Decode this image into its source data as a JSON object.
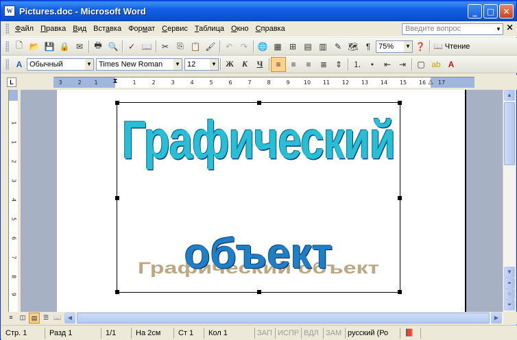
{
  "window": {
    "title": "Pictures.doc - Microsoft Word",
    "app_icon": "W"
  },
  "menubar": {
    "items": [
      {
        "pre": "",
        "u": "Ф",
        "post": "айл"
      },
      {
        "pre": "",
        "u": "П",
        "post": "равка"
      },
      {
        "pre": "",
        "u": "В",
        "post": "ид"
      },
      {
        "pre": "Вст",
        "u": "а",
        "post": "вка"
      },
      {
        "pre": "Фор",
        "u": "м",
        "post": "ат"
      },
      {
        "pre": "",
        "u": "С",
        "post": "ервис"
      },
      {
        "pre": "",
        "u": "Т",
        "post": "аблица"
      },
      {
        "pre": "",
        "u": "О",
        "post": "кно"
      },
      {
        "pre": "",
        "u": "С",
        "post": "правка"
      }
    ],
    "ask_placeholder": "Введите вопрос"
  },
  "standard_toolbar": {
    "zoom": "75%",
    "read_label": "Чтение"
  },
  "formatting_toolbar": {
    "style": "Обычный",
    "font": "Times New Roman",
    "size": "12",
    "bold": "Ж",
    "italic": "К",
    "underline": "Ч"
  },
  "ruler": {
    "corner": "L",
    "h_ticks": [
      "3",
      "2",
      "1",
      "1",
      "2",
      "3",
      "4",
      "5",
      "6",
      "7",
      "8",
      "9",
      "10",
      "11",
      "12",
      "13",
      "14",
      "15",
      "16",
      "17"
    ],
    "v_ticks": [
      "1",
      "1",
      "2",
      "3",
      "4",
      "5",
      "6",
      "7",
      "8",
      "9",
      "10"
    ]
  },
  "document": {
    "wordart_line1": "Графический",
    "wordart_line2": "объект",
    "wordart_shadow": "Графический объект"
  },
  "statusbar": {
    "page": "Стр. 1",
    "section": "Разд  1",
    "pages": "1/1",
    "at": "На  2см",
    "line": "Ст  1",
    "col": "Кол  1",
    "rec": "ЗАП",
    "trk": "ИСПР",
    "ext": "ВДЛ",
    "ovr": "ЗАМ",
    "lang": "русский (Ро"
  }
}
